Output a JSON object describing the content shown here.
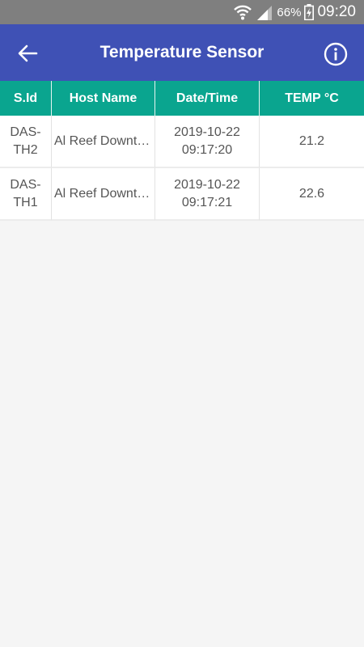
{
  "status_bar": {
    "battery_percent": "66%",
    "time": "09:20"
  },
  "toolbar": {
    "title": "Temperature Sensor",
    "back_icon": "arrow-left-icon",
    "info_icon": "info-circle-icon"
  },
  "table": {
    "headers": [
      "S.Id",
      "Host Name",
      "Date/Time",
      "TEMP °C"
    ],
    "rows": [
      {
        "sid_line1": "DAS-",
        "sid_line2": "TH2",
        "host": "Al Reef Downtown",
        "date": "2019-10-22",
        "time": "09:17:20",
        "temp": "21.2"
      },
      {
        "sid_line1": "DAS-",
        "sid_line2": "TH1",
        "host": "Al Reef Downtown",
        "date": "2019-10-22",
        "time": "09:17:21",
        "temp": "22.6"
      }
    ]
  },
  "colors": {
    "toolbar": "#3f51b5",
    "table_header": "#0aa58f",
    "status_bar": "#7f7f7f"
  }
}
